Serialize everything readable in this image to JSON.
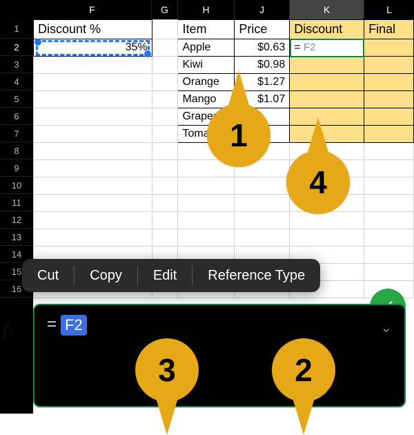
{
  "columns": [
    "F",
    "G",
    "H",
    "J",
    "K",
    "L"
  ],
  "selectedCol": "K",
  "rows": [
    "1",
    "2",
    "3",
    "4",
    "5",
    "6",
    "7",
    "8",
    "9",
    "10",
    "11",
    "12",
    "13",
    "14",
    "15",
    "16"
  ],
  "selectedRow": "2",
  "headers": {
    "F": "Discount %",
    "H": "Item",
    "J": "Price",
    "K": "Discount",
    "L": "Final"
  },
  "discountValue": "35%",
  "items": [
    {
      "name": "Apple",
      "price": "$0.63"
    },
    {
      "name": "Kiwi",
      "price": "$0.98"
    },
    {
      "name": "Orange",
      "price": "$1.27"
    },
    {
      "name": "Mango",
      "price": "$1.07"
    },
    {
      "name": "Grapes",
      "price": ""
    },
    {
      "name": "Tomato",
      "price": ""
    }
  ],
  "activeCell": {
    "eq": "=",
    "ref": "F2"
  },
  "context": {
    "cut": "Cut",
    "copy": "Copy",
    "edit": "Edit",
    "reftype": "Reference Type"
  },
  "fx": {
    "label_f": "f",
    "label_x": "x",
    "eq": "=",
    "ref": "F2"
  },
  "callouts": {
    "c1": "1",
    "c2": "2",
    "c3": "3",
    "c4": "4"
  }
}
